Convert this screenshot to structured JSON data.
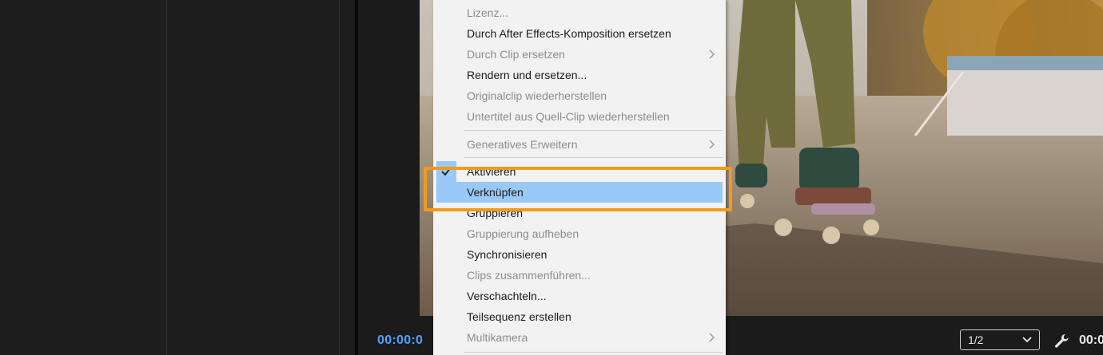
{
  "menu": {
    "items": [
      {
        "label": "Lizenz...",
        "enabled": false
      },
      {
        "label": "Durch After Effects-Komposition ersetzen",
        "enabled": true
      },
      {
        "label": "Durch Clip ersetzen",
        "enabled": false,
        "submenu": true
      },
      {
        "label": "Rendern und ersetzen...",
        "enabled": true
      },
      {
        "label": "Originalclip wiederherstellen",
        "enabled": false
      },
      {
        "label": "Untertitel aus Quell-Clip wiederherstellen",
        "enabled": false
      },
      {
        "label": "Generatives Erweitern",
        "enabled": false,
        "submenu": true
      },
      {
        "label": "Aktivieren",
        "enabled": true,
        "checked": true
      },
      {
        "label": "Verknüpfen",
        "enabled": true,
        "highlighted": true
      },
      {
        "label": "Gruppieren",
        "enabled": true
      },
      {
        "label": "Gruppierung aufheben",
        "enabled": false
      },
      {
        "label": "Synchronisieren",
        "enabled": true
      },
      {
        "label": "Clips zusammenführen...",
        "enabled": false
      },
      {
        "label": "Verschachteln...",
        "enabled": true
      },
      {
        "label": "Teilsequenz erstellen",
        "enabled": true
      },
      {
        "label": "Multikamera",
        "enabled": false,
        "submenu": true
      }
    ]
  },
  "monitor": {
    "timecode": "00:00:0",
    "zoom_value": "1/2",
    "timecode_right": "00:0"
  },
  "colors": {
    "highlight": "#99c9f7",
    "annotation": "#f39a1e",
    "timecode": "#4aa3ff"
  },
  "icons": {
    "check": "checkmark-icon",
    "submenu": "chevron-right-icon",
    "dropdown": "chevron-down-icon",
    "settings": "wrench-icon"
  }
}
